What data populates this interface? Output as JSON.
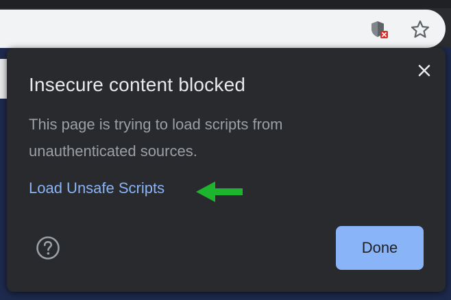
{
  "toolbar": {
    "shield_icon": "shield-blocked-icon",
    "star_icon": "star-bookmark-icon"
  },
  "bubble": {
    "title": "Insecure content blocked",
    "body": "This page is trying to load scripts from unauthenticated sources.",
    "link_label": "Load Unsafe Scripts",
    "done_label": "Done",
    "close_icon": "close-icon",
    "help_icon": "help-icon",
    "annotation_icon": "green-arrow-icon"
  },
  "colors": {
    "bubble_bg": "#292a2d",
    "link": "#8ab4f8",
    "done_button": "#8ab4f8",
    "arrow": "#1db52e",
    "blocked_badge": "#d93025"
  }
}
